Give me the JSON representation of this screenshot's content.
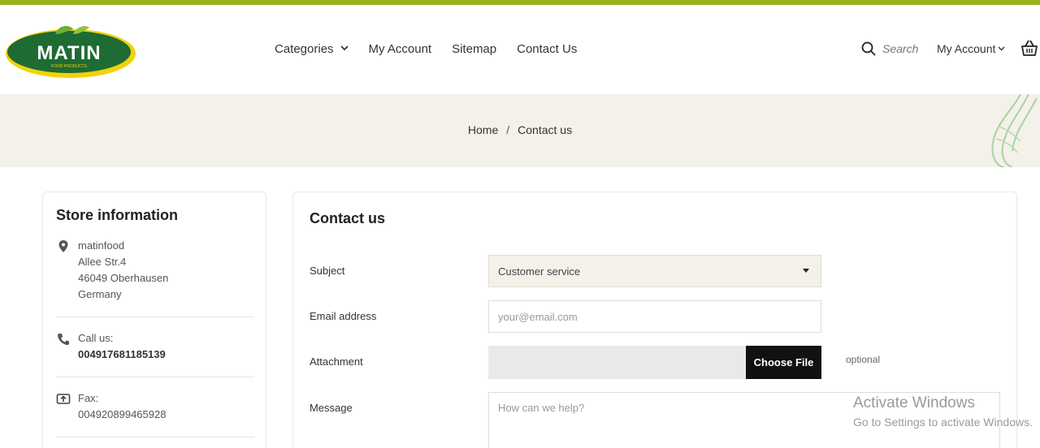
{
  "brand": {
    "name": "MATIN",
    "tagline": "FOOD PRODUCTS",
    "accent": "#97b41c",
    "logo_green": "#1e6b34",
    "logo_yellow": "#f2d20a"
  },
  "nav": {
    "items": [
      {
        "label": "Categories",
        "has_dropdown": true
      },
      {
        "label": "My Account",
        "has_dropdown": false
      },
      {
        "label": "Sitemap",
        "has_dropdown": false
      },
      {
        "label": "Contact Us",
        "has_dropdown": false
      }
    ]
  },
  "header": {
    "search_label": "Search",
    "account_label": "My Account",
    "cart_icon": "basket-icon"
  },
  "breadcrumb": {
    "home": "Home",
    "separator": "/",
    "current": "Contact us"
  },
  "store": {
    "title": "Store information",
    "address": {
      "icon": "location-pin-icon",
      "lines": [
        "matinfood",
        "Allee Str.4",
        "46049 Oberhausen",
        "Germany"
      ]
    },
    "phone": {
      "icon": "phone-icon",
      "label": "Call us:",
      "value": "004917681185139"
    },
    "fax": {
      "icon": "fax-icon",
      "label": "Fax:",
      "value": "004920899465928"
    }
  },
  "contact": {
    "title": "Contact us",
    "subject_label": "Subject",
    "subject_value": "Customer service",
    "email_label": "Email address",
    "email_placeholder": "your@email.com",
    "attachment_label": "Attachment",
    "file_button": "Choose File",
    "optional": "optional",
    "message_label": "Message",
    "message_placeholder": "How can we help?"
  },
  "watermark": {
    "line1": "Activate Windows",
    "line2": "Go to Settings to activate Windows."
  }
}
